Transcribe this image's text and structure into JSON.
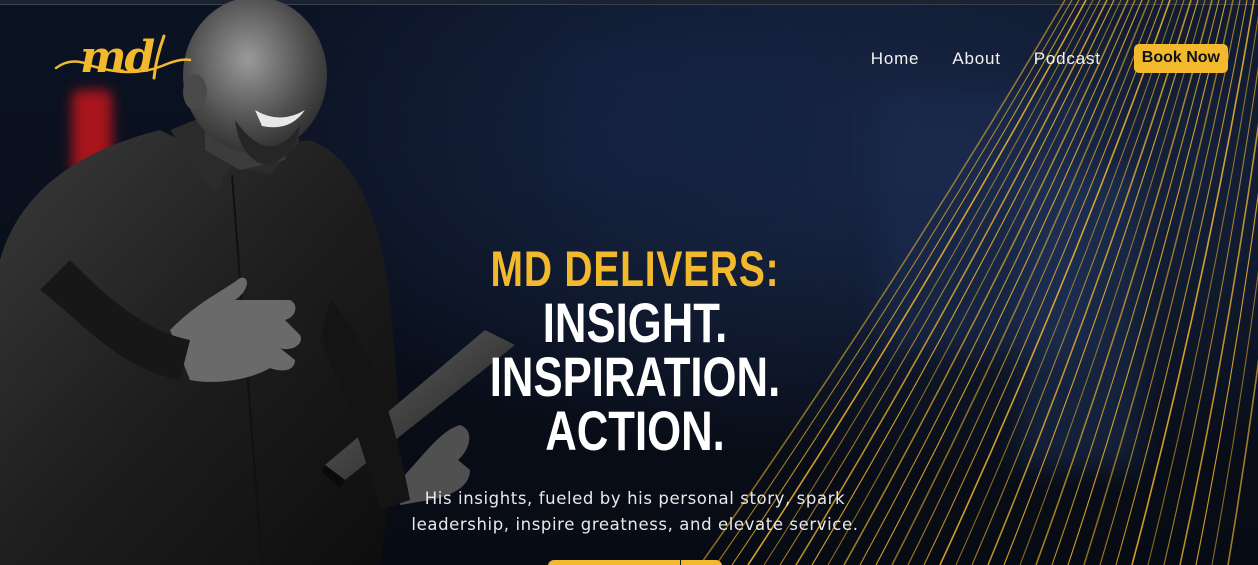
{
  "brand": {
    "logo_text": "md",
    "accent_color": "#f3b92c"
  },
  "nav": {
    "links": [
      "Home",
      "About",
      "Podcast"
    ],
    "book_now_label": "Book Now"
  },
  "hero": {
    "headline_accent": "MD DELIVERS:",
    "headline_lines": [
      "INSIGHT.",
      "INSPIRATION.",
      "ACTION."
    ],
    "subtitle_line1": "His insights, fueled by his personal story, spark",
    "subtitle_line2": "leadership, inspire greatness, and elevate service."
  },
  "images": {
    "speaker": "speaker-photo"
  }
}
